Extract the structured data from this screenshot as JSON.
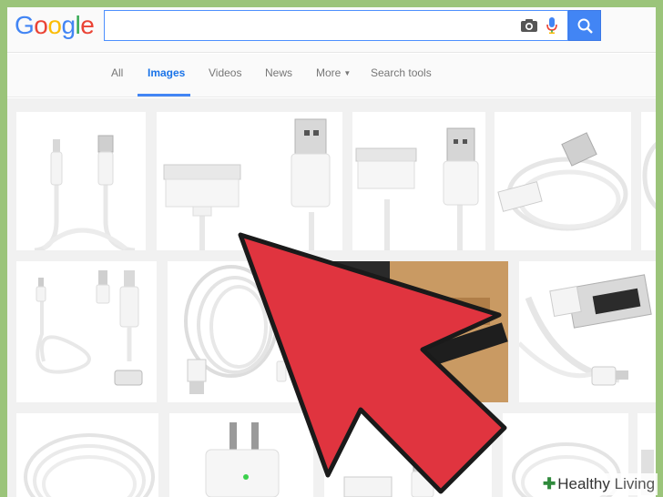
{
  "logo": {
    "letters": [
      "G",
      "o",
      "o",
      "g",
      "l",
      "e"
    ],
    "colors": [
      "#4285f4",
      "#ea4335",
      "#fbbc05",
      "#4285f4",
      "#34a853",
      "#ea4335"
    ]
  },
  "search": {
    "value": "",
    "placeholder": ""
  },
  "tabs": [
    {
      "label": "All",
      "active": false
    },
    {
      "label": "Images",
      "active": true
    },
    {
      "label": "Videos",
      "active": false
    },
    {
      "label": "News",
      "active": false
    },
    {
      "label": "More",
      "active": false
    },
    {
      "label": "Search tools",
      "active": false
    }
  ],
  "watermark": {
    "brand": "Healthy",
    "suffix": "Living"
  },
  "colors": {
    "accent": "#4285f4",
    "arrow_fill": "#e0343f",
    "arrow_stroke": "#1a1a1a",
    "page_border": "#9bc47a"
  },
  "icons": [
    "camera-icon",
    "mic-icon",
    "magnifier-icon",
    "chevron-down-icon",
    "arrow-pointer"
  ]
}
